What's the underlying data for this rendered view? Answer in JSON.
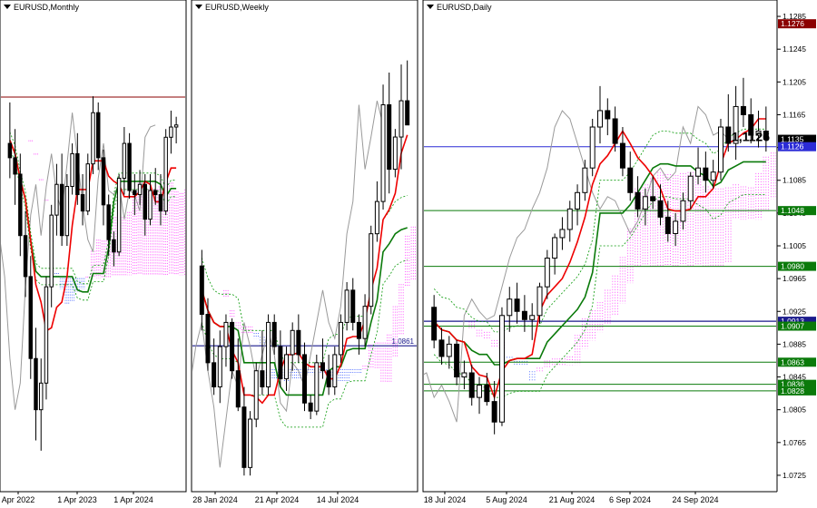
{
  "panels": [
    {
      "id": "monthly",
      "title": "EURUSD,Monthly",
      "x_labels": [
        "Apr 2022",
        "1 Apr 2023",
        "1 Apr 2024"
      ]
    },
    {
      "id": "weekly",
      "title": "EURUSD,Weekly",
      "x_labels": [
        "28 Jan 2024",
        "21 Apr 2024",
        "14 Jul 2024"
      ],
      "level_label": "1.0861"
    },
    {
      "id": "daily",
      "title": "EURUSD,Daily",
      "x_labels": [
        "18 Jul 2024",
        "5 Aug 2024",
        "21 Aug 2024",
        "6 Sep 2024",
        "24 Sep 2024"
      ]
    }
  ],
  "price_axis": {
    "ticks": [
      "1.1285",
      "1.1245",
      "1.1205",
      "1.1165",
      "1.1125",
      "1.1085",
      "1.1045",
      "1.1005",
      "1.0965",
      "1.0925",
      "1.0885",
      "1.0845",
      "1.0805",
      "1.0765",
      "1.0725"
    ],
    "tags": [
      {
        "text": "1.1276",
        "value": 1.1276,
        "color": "#8b0000"
      },
      {
        "text": "1.1135",
        "value": 1.1135,
        "color": "#000000"
      },
      {
        "text": "1.1126",
        "value": 1.1126,
        "color": "#2b2bd6"
      },
      {
        "text": "1.1048",
        "value": 1.1048,
        "color": "#0a7a0a"
      },
      {
        "text": "1.0980",
        "value": 1.098,
        "color": "#0a7a0a"
      },
      {
        "text": "1.0913",
        "value": 1.0913,
        "color": "#1a1a8c"
      },
      {
        "text": "1.0907",
        "value": 1.0907,
        "color": "#0a7a0a"
      },
      {
        "text": "1.0863",
        "value": 1.0863,
        "color": "#0a7a0a"
      },
      {
        "text": "1.0836",
        "value": 1.0836,
        "color": "#0a7a0a"
      },
      {
        "text": "1.0828",
        "value": 1.0828,
        "color": "#0a7a0a"
      }
    ]
  },
  "annotation": {
    "text": "1,1126",
    "value": 1.1126
  },
  "chart_data": [
    {
      "type": "candlestick",
      "title": "EURUSD,Monthly",
      "candles": [
        [
          1.105,
          1.125,
          1.088,
          1.098
        ],
        [
          1.098,
          1.112,
          1.075,
          1.09
        ],
        [
          1.09,
          1.1,
          1.05,
          1.06
        ],
        [
          1.06,
          1.072,
          1.03,
          1.04
        ],
        [
          1.04,
          1.05,
          0.99,
          1.0
        ],
        [
          1.0,
          1.015,
          0.96,
          0.975
        ],
        [
          0.975,
          1.0,
          0.955,
          0.988
        ],
        [
          0.988,
          1.04,
          0.98,
          1.035
        ],
        [
          1.035,
          1.075,
          1.025,
          1.07
        ],
        [
          1.07,
          1.095,
          1.06,
          1.085
        ],
        [
          1.085,
          1.1,
          1.055,
          1.06
        ],
        [
          1.06,
          1.09,
          1.055,
          1.084
        ],
        [
          1.084,
          1.105,
          1.08,
          1.1
        ],
        [
          1.1,
          1.11,
          1.075,
          1.08
        ],
        [
          1.08,
          1.09,
          1.065,
          1.072
        ],
        [
          1.072,
          1.1,
          1.07,
          1.095
        ],
        [
          1.095,
          1.128,
          1.09,
          1.12
        ],
        [
          1.12,
          1.125,
          1.092,
          1.098
        ],
        [
          1.098,
          1.102,
          1.065,
          1.075
        ],
        [
          1.075,
          1.08,
          1.05,
          1.058
        ],
        [
          1.058,
          1.062,
          1.045,
          1.052
        ],
        [
          1.052,
          1.09,
          1.05,
          1.088
        ],
        [
          1.088,
          1.113,
          1.08,
          1.105
        ],
        [
          1.105,
          1.11,
          1.078,
          1.082
        ],
        [
          1.082,
          1.09,
          1.07,
          1.08
        ],
        [
          1.08,
          1.092,
          1.075,
          1.085
        ],
        [
          1.085,
          1.09,
          1.06,
          1.068
        ],
        [
          1.068,
          1.09,
          1.065,
          1.082
        ],
        [
          1.082,
          1.093,
          1.075,
          1.08
        ],
        [
          1.08,
          1.09,
          1.065,
          1.072
        ],
        [
          1.072,
          1.112,
          1.07,
          1.108
        ],
        [
          1.108,
          1.121,
          1.1,
          1.113
        ],
        [
          1.113,
          1.118,
          1.105,
          1.114
        ]
      ],
      "series": [
        {
          "kind": "resistance",
          "value": 1.1276
        }
      ]
    },
    {
      "type": "candlestick",
      "title": "EURUSD,Weekly",
      "candles": [
        [
          1.096,
          1.098,
          1.088,
          1.09
        ],
        [
          1.09,
          1.092,
          1.083,
          1.084
        ],
        [
          1.084,
          1.087,
          1.08,
          1.081
        ],
        [
          1.081,
          1.088,
          1.079,
          1.086
        ],
        [
          1.086,
          1.09,
          1.0835,
          1.089
        ],
        [
          1.089,
          1.0895,
          1.082,
          1.083
        ],
        [
          1.083,
          1.087,
          1.078,
          1.0785
        ],
        [
          1.0785,
          1.081,
          1.07,
          1.071
        ],
        [
          1.071,
          1.078,
          1.07,
          1.077
        ],
        [
          1.077,
          1.084,
          1.076,
          1.083
        ],
        [
          1.083,
          1.088,
          1.08,
          1.081
        ],
        [
          1.081,
          1.09,
          1.08,
          1.089
        ],
        [
          1.089,
          1.09,
          1.085,
          1.086
        ],
        [
          1.086,
          1.088,
          1.081,
          1.082
        ],
        [
          1.082,
          1.086,
          1.0805,
          1.085
        ],
        [
          1.085,
          1.089,
          1.083,
          1.088
        ],
        [
          1.088,
          1.09,
          1.084,
          1.085
        ],
        [
          1.085,
          1.0865,
          1.078,
          1.079
        ],
        [
          1.079,
          1.08,
          1.077,
          1.078
        ],
        [
          1.078,
          1.085,
          1.0775,
          1.084
        ],
        [
          1.084,
          1.087,
          1.082,
          1.083
        ],
        [
          1.083,
          1.085,
          1.08,
          1.081
        ],
        [
          1.081,
          1.086,
          1.08,
          1.085
        ],
        [
          1.085,
          1.09,
          1.084,
          1.089
        ],
        [
          1.089,
          1.094,
          1.088,
          1.093
        ],
        [
          1.093,
          1.0945,
          1.088,
          1.089
        ],
        [
          1.089,
          1.09,
          1.085,
          1.087
        ],
        [
          1.087,
          1.0925,
          1.086,
          1.091
        ],
        [
          1.091,
          1.101,
          1.09,
          1.1
        ],
        [
          1.1,
          1.1065,
          1.099,
          1.104
        ],
        [
          1.104,
          1.1185,
          1.103,
          1.116
        ],
        [
          1.116,
          1.12,
          1.105,
          1.108
        ],
        [
          1.108,
          1.113,
          1.107,
          1.112
        ],
        [
          1.112,
          1.121,
          1.108,
          1.1165
        ],
        [
          1.1165,
          1.1215,
          1.115,
          1.1135
        ]
      ],
      "series": [
        {
          "kind": "level",
          "value": 1.0861
        }
      ]
    },
    {
      "type": "candlestick",
      "title": "EURUSD,Daily",
      "candles": [
        [
          1.093,
          1.0945,
          1.088,
          1.089
        ],
        [
          1.089,
          1.0905,
          1.086,
          1.087
        ],
        [
          1.087,
          1.0895,
          1.0855,
          1.0885
        ],
        [
          1.0885,
          1.089,
          1.0835,
          1.0845
        ],
        [
          1.0845,
          1.0865,
          1.083,
          1.085
        ],
        [
          1.085,
          1.086,
          1.081,
          1.082
        ],
        [
          1.082,
          1.0845,
          1.08,
          1.0835
        ],
        [
          1.0835,
          1.085,
          1.081,
          1.0815
        ],
        [
          1.0815,
          1.084,
          1.0775,
          1.079
        ],
        [
          1.079,
          1.093,
          1.0785,
          1.092
        ],
        [
          1.092,
          1.0955,
          1.09,
          1.094
        ],
        [
          1.094,
          1.096,
          1.091,
          1.0925
        ],
        [
          1.0925,
          1.0945,
          1.09,
          1.0915
        ],
        [
          1.0915,
          1.0935,
          1.089,
          1.092
        ],
        [
          1.092,
          1.096,
          1.091,
          1.0955
        ],
        [
          1.0955,
          1.1,
          1.094,
          1.099
        ],
        [
          1.099,
          1.102,
          1.097,
          1.1015
        ],
        [
          1.1015,
          1.104,
          1.1,
          1.1025
        ],
        [
          1.1025,
          1.106,
          1.101,
          1.105
        ],
        [
          1.105,
          1.108,
          1.103,
          1.107
        ],
        [
          1.107,
          1.111,
          1.106,
          1.11
        ],
        [
          1.11,
          1.116,
          1.109,
          1.115
        ],
        [
          1.115,
          1.12,
          1.113,
          1.117
        ],
        [
          1.117,
          1.1185,
          1.114,
          1.116
        ],
        [
          1.116,
          1.1175,
          1.112,
          1.113
        ],
        [
          1.113,
          1.115,
          1.109,
          1.11
        ],
        [
          1.11,
          1.112,
          1.106,
          1.107
        ],
        [
          1.107,
          1.109,
          1.104,
          1.105
        ],
        [
          1.105,
          1.1075,
          1.103,
          1.1065
        ],
        [
          1.1065,
          1.109,
          1.105,
          1.106
        ],
        [
          1.106,
          1.108,
          1.103,
          1.104
        ],
        [
          1.104,
          1.106,
          1.101,
          1.102
        ],
        [
          1.102,
          1.1045,
          1.1005,
          1.1035
        ],
        [
          1.1035,
          1.107,
          1.1025,
          1.106
        ],
        [
          1.106,
          1.1095,
          1.105,
          1.109
        ],
        [
          1.109,
          1.1125,
          1.108,
          1.11
        ],
        [
          1.11,
          1.112,
          1.107,
          1.1085
        ],
        [
          1.1085,
          1.111,
          1.1075,
          1.1095
        ],
        [
          1.1095,
          1.116,
          1.1085,
          1.115
        ],
        [
          1.115,
          1.119,
          1.112,
          1.113
        ],
        [
          1.113,
          1.12,
          1.111,
          1.1175
        ],
        [
          1.1175,
          1.121,
          1.115,
          1.1165
        ],
        [
          1.1165,
          1.1185,
          1.113,
          1.114
        ],
        [
          1.114,
          1.117,
          1.1125,
          1.1145
        ],
        [
          1.1145,
          1.1175,
          1.112,
          1.1135
        ]
      ],
      "series": [
        {
          "kind": "support",
          "value": 1.1048
        },
        {
          "kind": "support",
          "value": 1.098
        },
        {
          "kind": "level",
          "value": 1.0913
        },
        {
          "kind": "support",
          "value": 1.0907
        },
        {
          "kind": "support",
          "value": 1.0863
        },
        {
          "kind": "support",
          "value": 1.0836
        },
        {
          "kind": "support",
          "value": 1.0828
        },
        {
          "kind": "current",
          "value": 1.1126
        }
      ]
    }
  ]
}
